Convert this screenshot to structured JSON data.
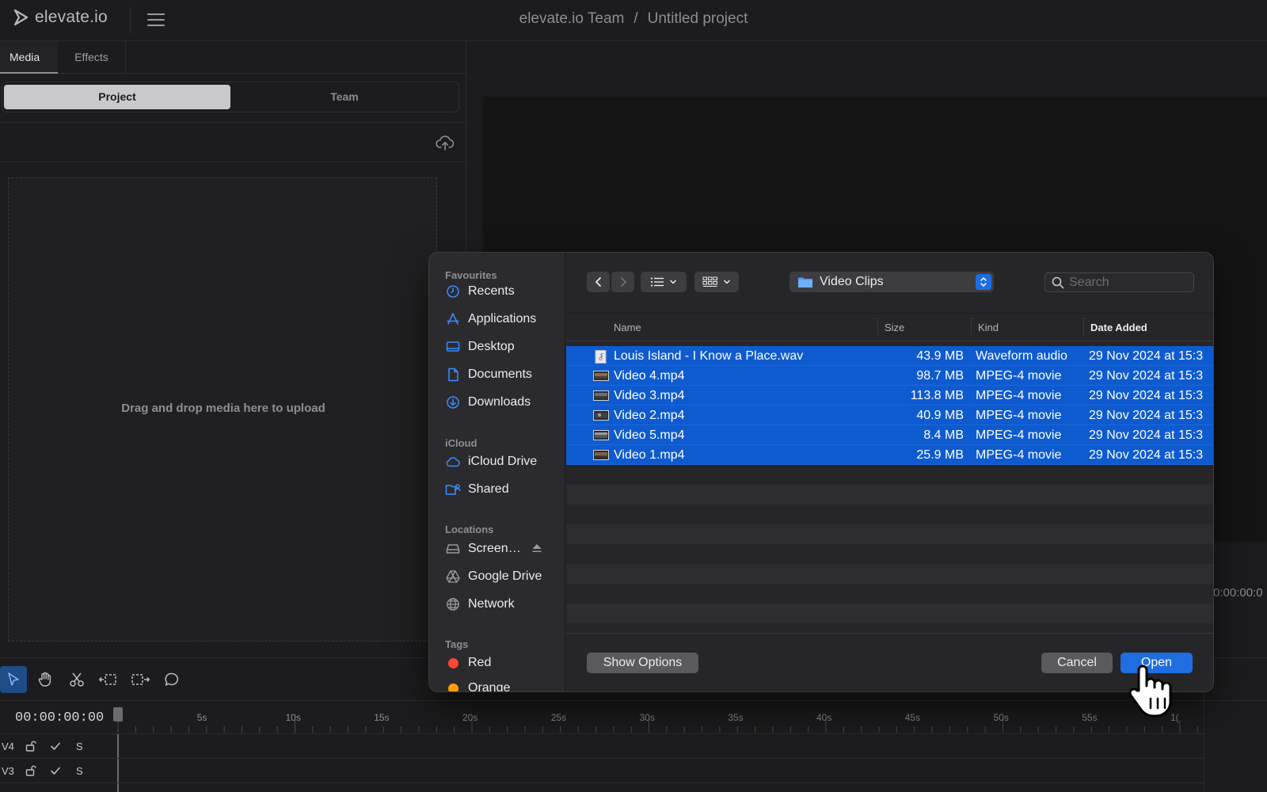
{
  "app": {
    "logo_text": "elevate.io",
    "team": "elevate.io Team",
    "separator": "/",
    "project": "Untitled project"
  },
  "left_panel": {
    "tabs": [
      {
        "label": "Media",
        "active": true
      },
      {
        "label": "Effects",
        "active": false
      }
    ],
    "segments": [
      {
        "label": "Project",
        "active": true
      },
      {
        "label": "Team",
        "active": false
      }
    ],
    "dropzone_text": "Drag and drop media here to upload"
  },
  "preview": {
    "timecode_partial": "0:00:00:0"
  },
  "timeline": {
    "timecode": "00:00:00:00",
    "ticks": [
      "5s",
      "10s",
      "15s",
      "20s",
      "25s",
      "30s",
      "35s",
      "40s",
      "45s",
      "50s",
      "55s",
      "1("
    ],
    "tracks": [
      {
        "label": "V4",
        "solo": "S"
      },
      {
        "label": "V3",
        "solo": "S"
      }
    ],
    "tools": [
      "select-icon",
      "hand-icon",
      "scissors-icon",
      "trim-left-icon",
      "trim-right-icon",
      "comment-icon"
    ]
  },
  "dialog": {
    "sidebar": {
      "favourites_heading": "Favourites",
      "favourites": [
        {
          "label": "Recents",
          "icon": "clock-icon"
        },
        {
          "label": "Applications",
          "icon": "applications-icon"
        },
        {
          "label": "Desktop",
          "icon": "desktop-icon"
        },
        {
          "label": "Documents",
          "icon": "document-icon"
        },
        {
          "label": "Downloads",
          "icon": "download-icon"
        }
      ],
      "icloud_heading": "iCloud",
      "icloud": [
        {
          "label": "iCloud Drive",
          "icon": "cloud-icon"
        },
        {
          "label": "Shared",
          "icon": "shared-folder-icon"
        }
      ],
      "locations_heading": "Locations",
      "locations": [
        {
          "label": "Screen…",
          "icon": "drive-icon"
        },
        {
          "label": "Google Drive",
          "icon": "google-drive-icon"
        },
        {
          "label": "Network",
          "icon": "globe-icon"
        }
      ],
      "tags_heading": "Tags",
      "tags": [
        {
          "label": "Red",
          "color": "#ff453a"
        },
        {
          "label": "Orange",
          "color": "#ff9f0a"
        }
      ]
    },
    "folder": "Video Clips",
    "search_placeholder": "Search",
    "columns": {
      "name": "Name",
      "size": "Size",
      "kind": "Kind",
      "date": "Date Added"
    },
    "files": [
      {
        "name": "Louis Island - I Know a Place.wav",
        "size": "43.9 MB",
        "kind": "Waveform audio",
        "date": "29 Nov 2024 at 15:3",
        "type": "audio"
      },
      {
        "name": "Video 4.mp4",
        "size": "98.7 MB",
        "kind": "MPEG-4 movie",
        "date": "29 Nov 2024 at 15:3",
        "type": "video"
      },
      {
        "name": "Video 3.mp4",
        "size": "113.8 MB",
        "kind": "MPEG-4 movie",
        "date": "29 Nov 2024 at 15:3",
        "type": "video"
      },
      {
        "name": "Video 2.mp4",
        "size": "40.9 MB",
        "kind": "MPEG-4 movie",
        "date": "29 Nov 2024 at 15:3",
        "type": "video"
      },
      {
        "name": "Video 5.mp4",
        "size": "8.4 MB",
        "kind": "MPEG-4 movie",
        "date": "29 Nov 2024 at 15:3",
        "type": "video"
      },
      {
        "name": "Video 1.mp4",
        "size": "25.9 MB",
        "kind": "MPEG-4 movie",
        "date": "29 Nov 2024 at 15:3",
        "type": "video"
      }
    ],
    "buttons": {
      "show_options": "Show Options",
      "cancel": "Cancel",
      "open": "Open"
    }
  },
  "colors": {
    "accent": "#1f6de0",
    "selection": "#0e5bd0",
    "background": "#1c1c1e"
  }
}
